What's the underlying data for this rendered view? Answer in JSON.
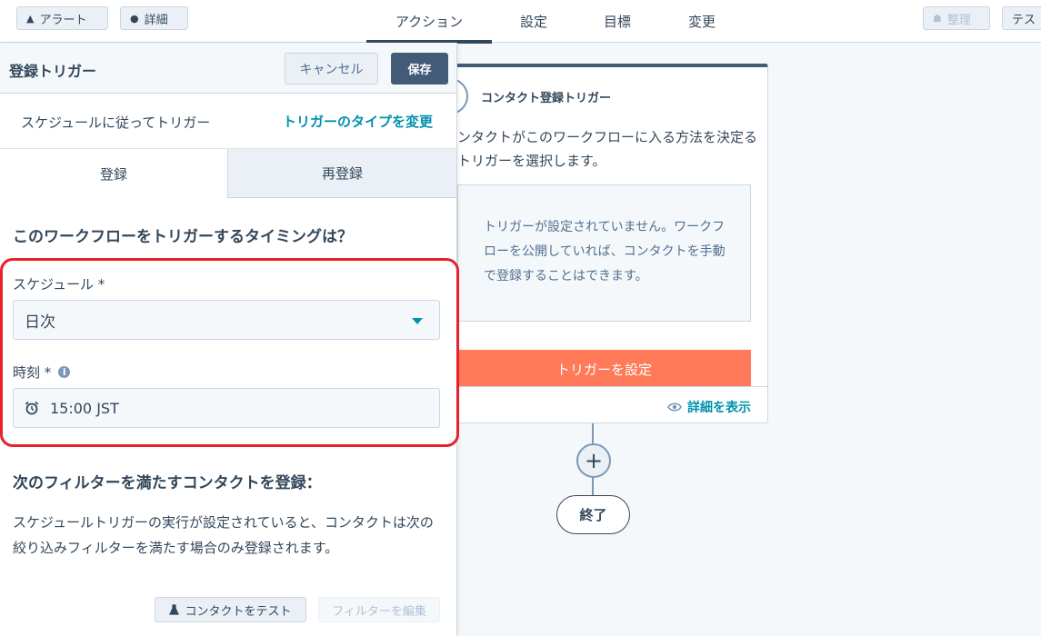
{
  "toolbar": {
    "alert_label": "アラート",
    "alert_icon": "warning-triangle-icon",
    "details_label": "詳細",
    "details_icon": "info-icon",
    "organize_label": "整理",
    "organize_icon": "organize-icon",
    "test_label": "テス"
  },
  "tabs": [
    {
      "label": "アクション",
      "active": true
    },
    {
      "label": "設定",
      "active": false
    },
    {
      "label": "目標",
      "active": false
    },
    {
      "label": "変更",
      "active": false
    }
  ],
  "panel": {
    "title": "登録トリガー",
    "cancel_label": "キャンセル",
    "save_label": "保存",
    "trigger_type_label": "スケジュールに従ってトリガー",
    "change_type_label": "トリガーのタイプを変更",
    "subtabs": [
      {
        "label": "登録",
        "active": true
      },
      {
        "label": "再登録",
        "active": false
      }
    ],
    "timing_question": "このワークフローをトリガーするタイミングは？",
    "schedule_label": "スケジュール *",
    "schedule_value": "日次",
    "time_label": "時刻 *",
    "time_value": "15:00 JST",
    "filter_heading": "次のフィルターを満たすコンタクトを登録：",
    "filter_description": "スケジュールトリガーの実行が設定されていると、コンタクトは次の絞り込みフィルターを満たす場合のみ登録されます。",
    "test_contact_label": "コンタクトをテスト",
    "edit_filter_label": "フィルターを編集"
  },
  "workflow": {
    "trigger_title": "コンタクト登録トリガー",
    "trigger_description": "ンタクトがこのワークフローに入る方法を決定るトリガーを選択します。",
    "empty_message": "トリガーが設定されていません。ワークフローを公開していれば、コンタクトを手動で登録することはできます。",
    "set_trigger_label": "トリガーを設定",
    "show_details_label": "詳細を表示",
    "add_action_symbol": "+",
    "end_label": "終了"
  },
  "colors": {
    "accent_teal": "#0091ae",
    "primary_dark": "#425b76",
    "orange_cta": "#ff7a59",
    "highlight_red": "#e8202a"
  }
}
